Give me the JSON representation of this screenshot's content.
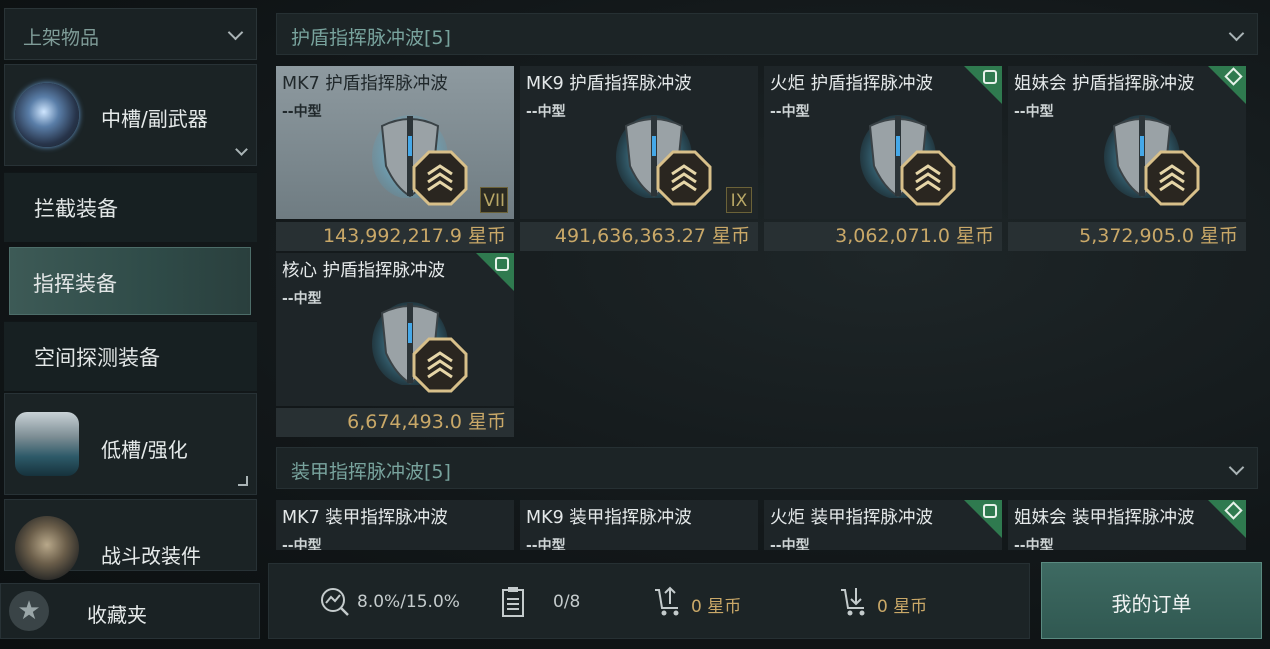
{
  "left": {
    "listed_label": "上架物品",
    "categories": [
      {
        "label": "中槽/副武器",
        "icon": "lightning-orb-icon"
      },
      {
        "label": "低槽/强化",
        "icon": "medkit-module-icon"
      },
      {
        "label": "战斗改装件",
        "icon": "rig-cylinders-icon"
      }
    ],
    "subcategories": [
      {
        "label": "拦截装备",
        "active": false
      },
      {
        "label": "指挥装备",
        "active": true
      },
      {
        "label": "空间探测装备",
        "active": false
      }
    ],
    "favorites_label": "收藏夹"
  },
  "sections": [
    {
      "title": "护盾指挥脉冲波[5]",
      "items": [
        {
          "name": "MK7 护盾指挥脉冲波",
          "size": "--中型",
          "price": "143,992,217.9 星币",
          "tier": "VII",
          "badge": ""
        },
        {
          "name": "MK9 护盾指挥脉冲波",
          "size": "--中型",
          "price": "491,636,363.27 星币",
          "tier": "IX",
          "badge": ""
        },
        {
          "name": "火炬 护盾指挥脉冲波",
          "size": "--中型",
          "price": "3,062,071.0 星币",
          "tier": "",
          "badge": "square"
        },
        {
          "name": "姐妹会 护盾指挥脉冲波",
          "size": "--中型",
          "price": "5,372,905.0 星币",
          "tier": "",
          "badge": "diamond"
        },
        {
          "name": "核心 护盾指挥脉冲波",
          "size": "--中型",
          "price": "6,674,493.0 星币",
          "tier": "",
          "badge": "square"
        }
      ]
    },
    {
      "title": "装甲指挥脉冲波[5]",
      "items": [
        {
          "name": "MK7 装甲指挥脉冲波",
          "size": "--中型"
        },
        {
          "name": "MK9 装甲指挥脉冲波",
          "size": "--中型"
        },
        {
          "name": "火炬 装甲指挥脉冲波",
          "size": "--中型",
          "badge": "square"
        },
        {
          "name": "姐妹会 装甲指挥脉冲波",
          "size": "--中型",
          "badge": "diamond"
        }
      ]
    }
  ],
  "bottom": {
    "tax_rate": "8.0%/15.0%",
    "orders_count": "0/8",
    "sell_total": "0 星币",
    "buy_total": "0 星币",
    "my_orders_label": "我的订单"
  },
  "colors": {
    "accent": "#3e6a62",
    "price": "#c9a868",
    "section_title": "#78a39d",
    "badge": "#2f7a4f"
  }
}
